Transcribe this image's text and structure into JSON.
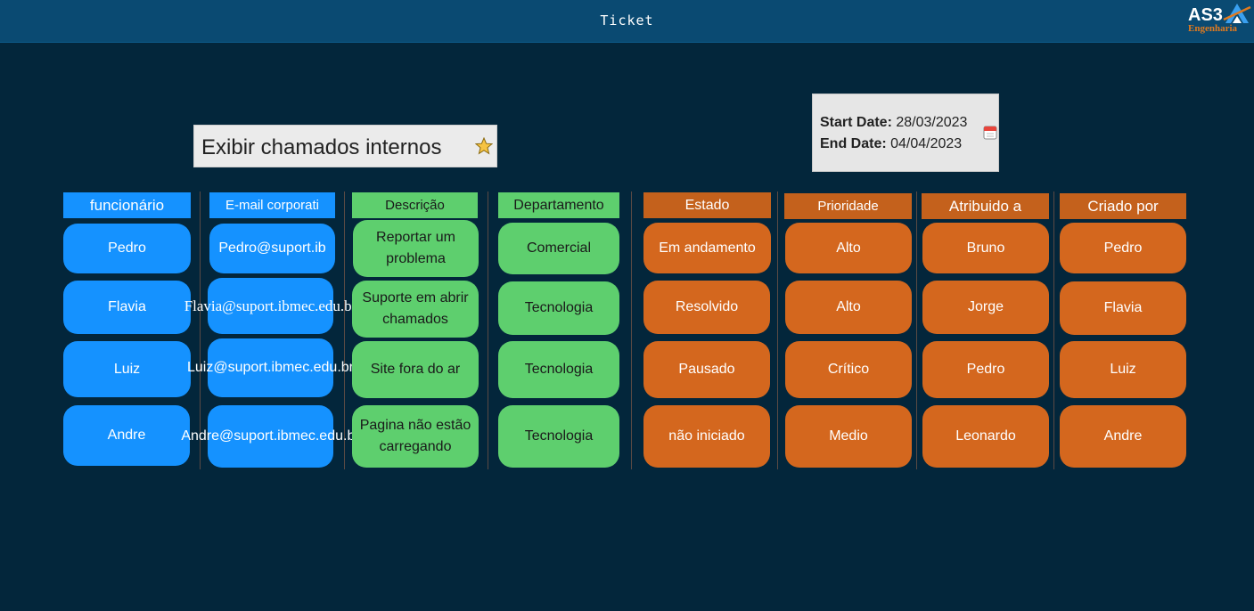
{
  "window": {
    "title": "Ticket"
  },
  "logo": {
    "brand": "AS3",
    "subtitle": "Engenharia"
  },
  "search": {
    "label": "Exibir chamados internos"
  },
  "dates": {
    "start_label": "Start Date:",
    "start_value": "28/03/2023",
    "end_label": "End Date:",
    "end_value": "04/04/2023"
  },
  "columns": [
    {
      "header": "funcionário",
      "color": "#1592ff",
      "cells": [
        "Pedro",
        "Flavia",
        "Luiz",
        "Andre"
      ]
    },
    {
      "header": "E-mail corporati",
      "color": "#1592ff",
      "cells": [
        "Pedro@suport.ib",
        "Flavia@suport.ibmec.edu.br",
        "Luiz@suport.ibmec.edu.br",
        "Andre@suport.ibmec.edu.br"
      ]
    },
    {
      "header": "Descrição",
      "color": "#5ecf6e",
      "cells": [
        "Reportar um problema",
        "Suporte em abrir chamados",
        "Site fora do ar",
        "Pagina não estão carregando"
      ]
    },
    {
      "header": "Departamento",
      "color": "#5ecf6e",
      "cells": [
        "Comercial",
        "Tecnologia",
        "Tecnologia",
        "Tecnologia"
      ]
    },
    {
      "header": "Estado",
      "color": "#c4611c",
      "cells": [
        "Em andamento",
        "Resolvido",
        "Pausado",
        "não iniciado"
      ]
    },
    {
      "header": "Prioridade",
      "color": "#c4611c",
      "cells": [
        "Alto",
        "Alto",
        "Crítico",
        "Medio"
      ]
    },
    {
      "header": "Atribuido a",
      "color": "#c4611c",
      "cells": [
        "Bruno",
        "Jorge",
        "Pedro",
        "Leonardo"
      ]
    },
    {
      "header": "Criado por",
      "color": "#c4611c",
      "cells": [
        "Pedro",
        "Flavia",
        "Luiz",
        "Andre"
      ]
    }
  ],
  "icons": {
    "favorite": "star-icon",
    "calendar": "calendar-icon",
    "logo": "as3-logo-icon"
  }
}
